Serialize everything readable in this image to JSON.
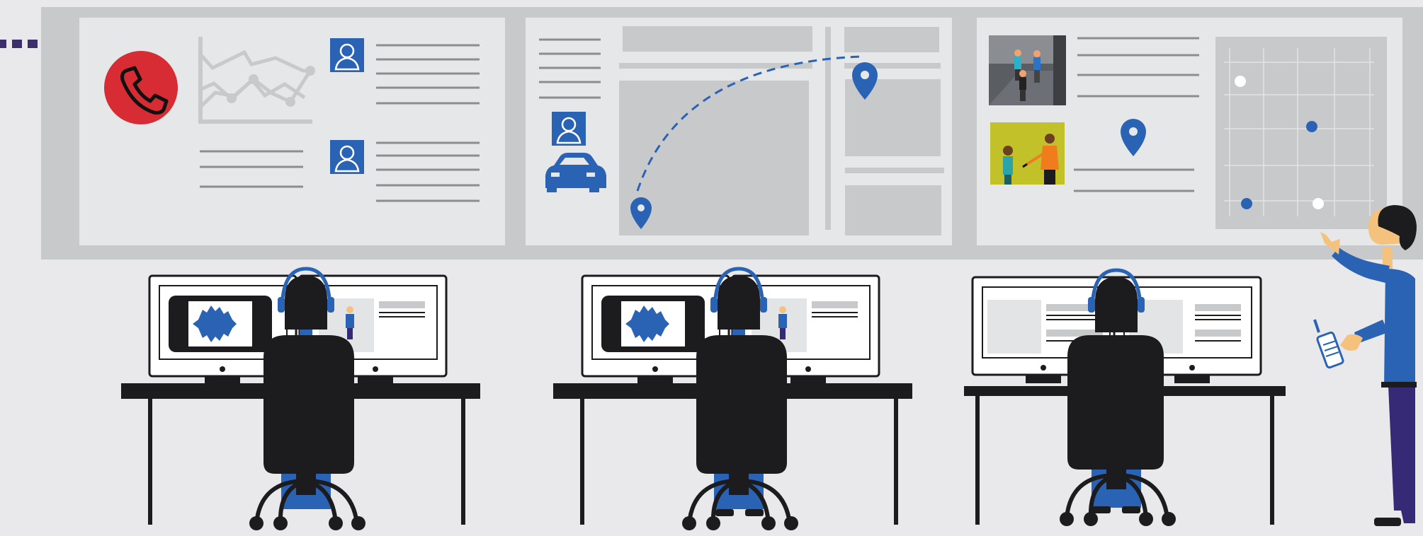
{
  "colors": {
    "background": "#e9e9eb",
    "wall": "#c8c9cb",
    "panel": "#e6e7e8",
    "block": "#c8c9cb",
    "text_line": "#8c8d8f",
    "accent_blue": "#2b63b4",
    "alert_red": "#d72c33",
    "silhouette": "#1c1b1d",
    "skin": "#f4c27c",
    "pants_purple": "#362a77",
    "photo_yellow": "#c2c12a",
    "connector_dots": "#3c2e6b"
  },
  "icons": {
    "phone": "phone-icon",
    "contact": "contact-card-icon",
    "car": "car-icon",
    "location": "location-pin-icon",
    "audio": "audio-waveform-icon",
    "walkie_talkie": "walkie-talkie-icon",
    "headset": "headset-icon"
  },
  "panels": [
    {
      "id": "call-panel",
      "content": [
        "phone-icon",
        "line-chart",
        "contact-card-icon",
        "contact-card-icon",
        "text-lines"
      ]
    },
    {
      "id": "dispatch-map-panel",
      "content": [
        "text-lines",
        "contact-card-icon",
        "car-icon",
        "route-map",
        "location-pin-icon",
        "location-pin-icon"
      ]
    },
    {
      "id": "evidence-panel",
      "content": [
        "photo-street",
        "photo-people",
        "location-pin-icon",
        "text-lines",
        "grid-map"
      ]
    }
  ],
  "workstations": [
    {
      "id": "workstation-1",
      "operator": "operator-with-headset",
      "screens": [
        "audio-waveform-screen",
        "document-screen"
      ]
    },
    {
      "id": "workstation-2",
      "operator": "operator-with-headset",
      "screens": [
        "audio-waveform-screen",
        "document-screen"
      ]
    },
    {
      "id": "workstation-3",
      "operator": "operator-with-headset",
      "screens": [
        "document-screen",
        "document-screen"
      ]
    }
  ],
  "supervisor": {
    "holding": "walkie-talkie-icon",
    "gesture": "pointing"
  }
}
